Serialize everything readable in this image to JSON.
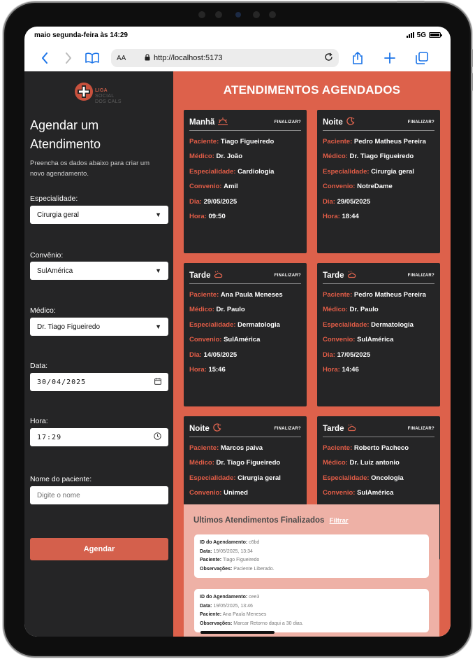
{
  "status": {
    "time_text": "maio segunda-feira às 14:29",
    "network": "5G"
  },
  "browser": {
    "aa_label": "AA",
    "url": "http://localhost:5173"
  },
  "brand": {
    "line1": "LIGA",
    "line2": "SOCIAL",
    "line3": "DOS CALS",
    "accent": "#d4604c"
  },
  "form": {
    "title": "Agendar um Atendimento",
    "subtitle": "Preencha os dados abaixo para criar um novo agendamento.",
    "especialidade_label": "Especialidade:",
    "especialidade_value": "Cirurgia geral",
    "convenio_label": "Convênio:",
    "convenio_value": "SulAmérica",
    "medico_label": "Médico:",
    "medico_value": "Dr. Tiago Figueiredo",
    "data_label": "Data:",
    "data_value": "30/04/2025",
    "hora_label": "Hora:",
    "hora_value": "17:29",
    "paciente_label": "Nome do paciente:",
    "paciente_placeholder": "Digite o nome",
    "submit_label": "Agendar"
  },
  "agenda": {
    "title": "ATENDIMENTOS AGENDADOS",
    "finalize_label": "FINALIZAR?",
    "keys": {
      "paciente": "Paciente:",
      "medico": "Médico:",
      "especialidade": "Especialidade:",
      "convenio": "Convenio:",
      "dia": "Dia:",
      "hora": "Hora:"
    },
    "cards": [
      {
        "period": "Manhã",
        "icon": "sunrise-icon",
        "paciente": "Tiago Figueiredo",
        "medico": "Dr. João",
        "especialidade": "Cardiologia",
        "convenio": "Amil",
        "dia": "29/05/2025",
        "hora": "09:50"
      },
      {
        "period": "Noite",
        "icon": "moon-icon",
        "paciente": "Pedro Matheus Pereira",
        "medico": "Dr. Tiago Figueiredo",
        "especialidade": "Cirurgia geral",
        "convenio": "NotreDame",
        "dia": "29/05/2025",
        "hora": "18:44"
      },
      {
        "period": "Tarde",
        "icon": "sun-cloud-icon",
        "paciente": "Ana Paula Meneses",
        "medico": "Dr. Paulo",
        "especialidade": "Dermatologia",
        "convenio": "SulAmérica",
        "dia": "14/05/2025",
        "hora": "15:46"
      },
      {
        "period": "Tarde",
        "icon": "sun-cloud-icon",
        "paciente": "Pedro Matheus Pereira",
        "medico": "Dr. Paulo",
        "especialidade": "Dermatologia",
        "convenio": "SulAmérica",
        "dia": "17/05/2025",
        "hora": "14:46"
      },
      {
        "period": "Noite",
        "icon": "moon-icon",
        "paciente": "Marcos paiva",
        "medico": "Dr. Tiago Figueiredo",
        "especialidade": "Cirurgia geral",
        "convenio": "Unimed",
        "dia": "",
        "hora": ""
      },
      {
        "period": "Tarde",
        "icon": "sun-cloud-icon",
        "paciente": "Roberto Pacheco",
        "medico": "Dr. Luiz antonio",
        "especialidade": "Oncologia",
        "convenio": "SulAmérica",
        "dia": "",
        "hora": ""
      }
    ]
  },
  "finalizados": {
    "title": "Ultimos Atendimentos Finalizados",
    "filter_label": "Filtrar",
    "keys": {
      "id": "ID do Agendamento:",
      "data": "Data:",
      "paciente": "Paciente:",
      "observacoes": "Observações:"
    },
    "items": [
      {
        "id": "c6bd",
        "data": "19/05/2025, 13:34",
        "paciente": "Tiago Figueiredo",
        "observacoes": "Paciente Liberado."
      },
      {
        "id": "cee3",
        "data": "19/05/2025, 13:46",
        "paciente": "Ana Paula Meneses",
        "observacoes": "Marcar Retorno daqui a 30 dias."
      }
    ]
  }
}
